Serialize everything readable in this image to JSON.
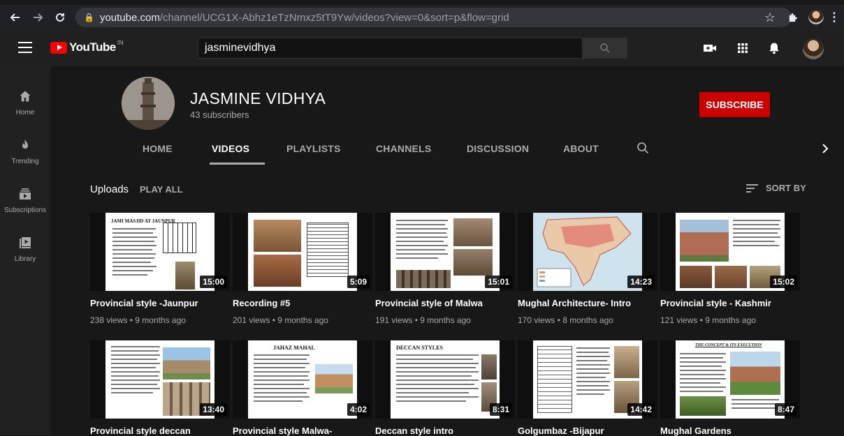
{
  "browser": {
    "url_host": "youtube.com",
    "url_path": "/channel/UCG1X-Abhz1eTzNmxz5tT9Yw/videos?view=0&sort=p&flow=grid"
  },
  "header": {
    "logo_text": "YouTube",
    "logo_country": "IN",
    "search_value": "jasminevidhya"
  },
  "nav": {
    "items": [
      {
        "label": "Home",
        "icon": "home-icon"
      },
      {
        "label": "Trending",
        "icon": "flame-icon"
      },
      {
        "label": "Subscriptions",
        "icon": "subscriptions-icon"
      },
      {
        "label": "Library",
        "icon": "library-icon"
      }
    ]
  },
  "channel": {
    "name": "JASMINE VIDHYA",
    "subscribers": "43 subscribers",
    "subscribe_label": "SUBSCRIBE",
    "tabs": [
      "HOME",
      "VIDEOS",
      "PLAYLISTS",
      "CHANNELS",
      "DISCUSSION",
      "ABOUT"
    ],
    "active_tab": "VIDEOS"
  },
  "uploads": {
    "heading": "Uploads",
    "play_all": "PLAY ALL",
    "sort_by": "SORT BY"
  },
  "videos": [
    {
      "title": "Provincial style -Jaunpur",
      "meta": "238 views • 9 months ago",
      "duration": "15:00",
      "slide_title": "JAMI MASJID AT JAUNPUR"
    },
    {
      "title": "Recording #5",
      "meta": "201 views • 9 months ago",
      "duration": "5:09"
    },
    {
      "title": "Provincial style of Malwa",
      "meta": "191 views • 9 months ago",
      "duration": "15:01"
    },
    {
      "title": "Mughal Architecture- Intro",
      "meta": "170 views • 8 months ago",
      "duration": "14:23"
    },
    {
      "title": "Provincial style - Kashmir",
      "meta": "121 views • 9 months ago",
      "duration": "15:02"
    },
    {
      "title": "Provincial style deccan",
      "meta": "",
      "duration": "13:40"
    },
    {
      "title": "Provincial style Malwa-",
      "meta": "",
      "duration": "4:02",
      "slide_title": "JAHAZ MAHAL"
    },
    {
      "title": "Deccan style intro",
      "meta": "",
      "duration": "8:31",
      "slide_title": "DECCAN STYLES"
    },
    {
      "title": "Golgumbaz -Bijapur",
      "meta": "",
      "duration": "14:42"
    },
    {
      "title": "Mughal Gardens",
      "meta": "",
      "duration": "8:47",
      "slide_title": "THE CONCEPT & ITS EXECUTION"
    }
  ]
}
